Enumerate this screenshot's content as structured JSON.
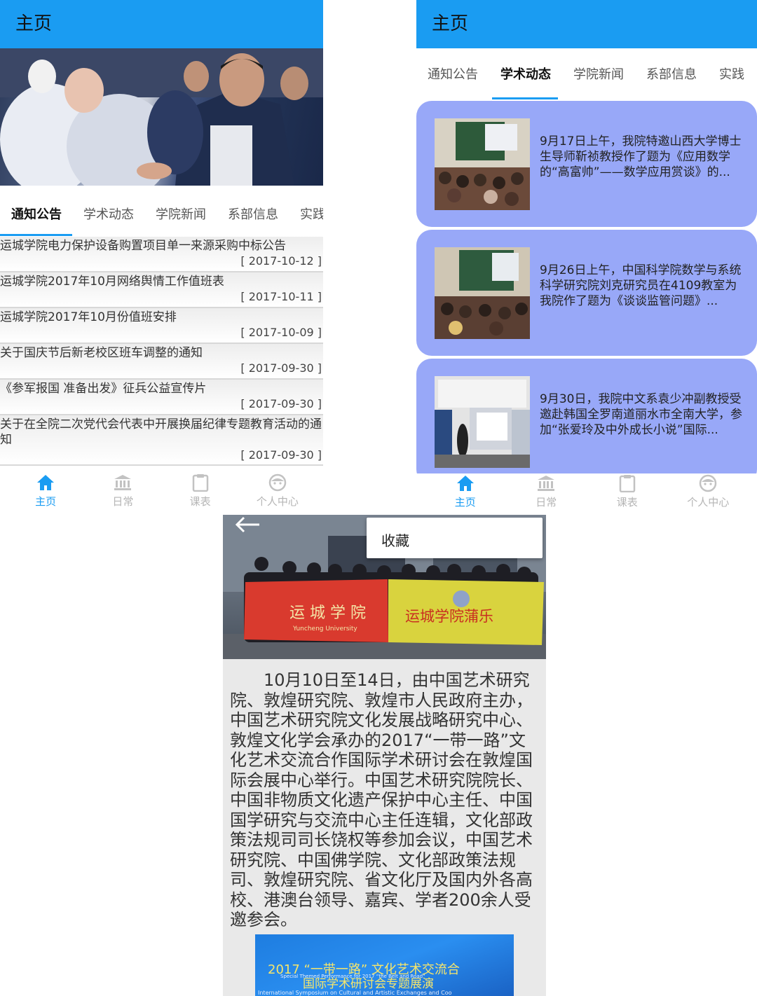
{
  "accent": "#1a9cf2",
  "card_color": "#98a8f8",
  "nav": {
    "home": "主页",
    "daily": "日常",
    "schedule": "课表",
    "profile": "个人中心"
  },
  "phone1": {
    "title": "主页",
    "tabs": [
      "通知公告",
      "学术动态",
      "学院新闻",
      "系部信息",
      "实践"
    ],
    "active_tab": "通知公告",
    "notices": [
      {
        "title": "运城学院电力保护设备购置项目单一来源采购中标公告",
        "date": "[ 2017-10-12 ]"
      },
      {
        "title": "运城学院2017年10月网络舆情工作值班表",
        "date": "[ 2017-10-11 ]"
      },
      {
        "title": "运城学院2017年10月份值班安排",
        "date": "[ 2017-10-09 ]"
      },
      {
        "title": "关于国庆节后新老校区班车调整的通知",
        "date": "[ 2017-09-30 ]"
      },
      {
        "title": "《参军报国 准备出发》征兵公益宣传片",
        "date": "[ 2017-09-30 ]"
      },
      {
        "title": "关于在全院二次党代会代表中开展换届纪律专题教育活动的通知",
        "date": "[ 2017-09-30 ]"
      }
    ]
  },
  "phone2": {
    "title": "主页",
    "tabs": [
      "通知公告",
      "学术动态",
      "学院新闻",
      "系部信息",
      "实践"
    ],
    "active_tab": "学术动态",
    "cards": [
      {
        "text": "9月17日上午，我院特邀山西大学博士生导师靳祯教授作了题为《应用数学的“高富帅”——数学应用赏谈》的..."
      },
      {
        "text": "9月26日上午，中国科学院数学与系统科学研究院刘克研究员在4109教室为我院作了题为《谈谈监管问题》..."
      },
      {
        "text": "9月30日，我院中文系袁少冲副教授受邀赴韩国全罗南道丽水市全南大学，参加“张爱玲及中外成长小说”国际..."
      }
    ]
  },
  "phone3": {
    "back_icon": "arrow-left-icon",
    "menu_item": "收藏",
    "banner_left": "运 城 学 院",
    "banner_left_sub": "Yuncheng University",
    "banner_right": "运城学院蒲乐",
    "article": "10月10日至14日，由中国艺术研究院、敦煌研究院、敦煌市人民政府主办，中国艺术研究院文化发展战略研究中心、敦煌文化学会承办的2017“一带一路”文化艺术交流合作国际学术研讨会在敦煌国际会展中心举行。中国艺术研究院院长、中国非物质文化遗产保护中心主任、中国国学研究与交流中心主任连辑，文化部政策法规司司长饶权等参加会议，中国艺术研究院、中国佛学院、文化部政策法规司、敦煌研究院、省文化厅及国内外各高校、港澳台领导、嘉宾、学者200余人受邀参会。",
    "poster_line1": "2017 “一带一路” 文化艺术交流合",
    "poster_line2": "Special Themed Performance for 2017 “the Belt and Road”",
    "poster_line3": "国际学术研讨会专题展演",
    "poster_line4": "International Symposium on Cultural and Artistic Exchanges and Coo"
  }
}
